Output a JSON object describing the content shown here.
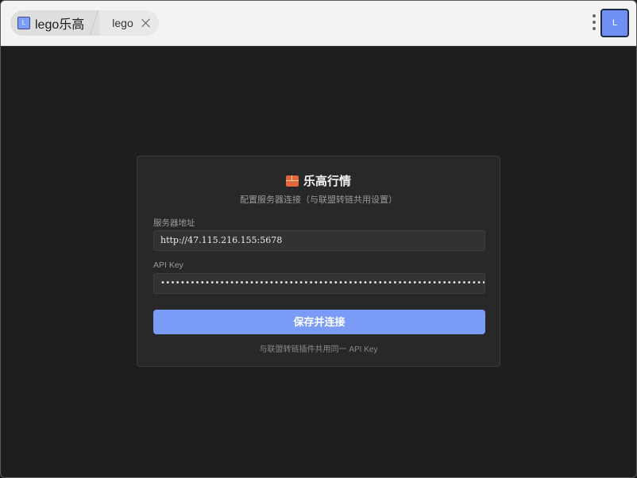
{
  "browser": {
    "tabs": [
      {
        "label": "lego乐高",
        "favicon": "L"
      },
      {
        "label": "lego"
      }
    ],
    "avatar_letter": "L"
  },
  "card": {
    "title": "乐高行情",
    "title_icon": "brick-icon",
    "subtitle": "配置服务器连接（与联盟转链共用设置）",
    "server": {
      "label": "服务器地址",
      "value": "http://47.115.216.155:5678"
    },
    "api_key": {
      "label": "API Key",
      "masked_value": "••••••••••••••••••••••••••••••••••••••••••••••••••••••••••••••••••••"
    },
    "save_button": "保存并连接",
    "footer": "与联盟转链插件共用同一 API Key"
  },
  "colors": {
    "accent": "#7a9cf6",
    "background": "#1e1e1e",
    "card": "#282828"
  }
}
